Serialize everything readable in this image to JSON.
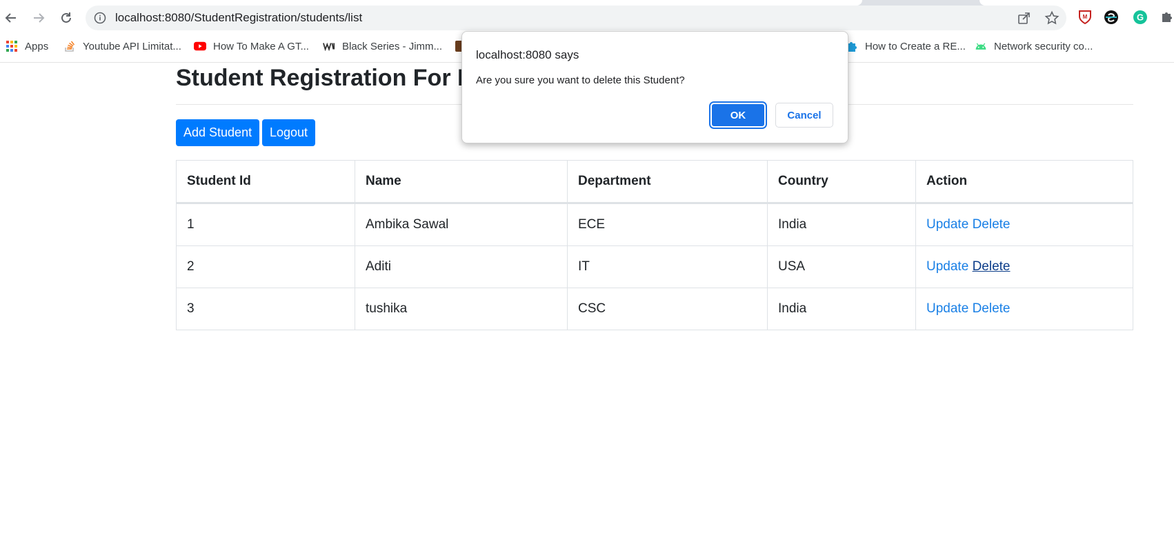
{
  "browser": {
    "url": "localhost:8080/StudentRegistration/students/list",
    "bookmarks": [
      {
        "label": "Apps",
        "icon": "apps-grid-icon"
      },
      {
        "label": "Youtube API Limitat...",
        "icon": "stackoverflow-icon"
      },
      {
        "label": "How To Make A GT...",
        "icon": "youtube-icon"
      },
      {
        "label": "Black Series - Jimm...",
        "icon": "wix-icon"
      },
      {
        "label": "How to Create a RE...",
        "icon": "puzzle-icon"
      },
      {
        "label": "Network security co...",
        "icon": "android-icon"
      }
    ]
  },
  "page": {
    "title": "Student Registration For D",
    "add_button": "Add Student",
    "logout_button": "Logout"
  },
  "table": {
    "headers": [
      "Student Id",
      "Name",
      "Department",
      "Country",
      "Action"
    ],
    "rows": [
      {
        "id": "1",
        "name": "Ambika Sawal",
        "department": "ECE",
        "country": "India",
        "update": "Update",
        "delete": "Delete"
      },
      {
        "id": "2",
        "name": "Aditi",
        "department": "IT",
        "country": "USA",
        "update": "Update",
        "delete": "Delete"
      },
      {
        "id": "3",
        "name": "tushika",
        "department": "CSC",
        "country": "India",
        "update": "Update",
        "delete": "Delete"
      }
    ]
  },
  "dialog": {
    "title": "localhost:8080 says",
    "message": "Are you sure you want to delete this Student?",
    "ok_label": "OK",
    "cancel_label": "Cancel"
  },
  "colors": {
    "primary": "#007bff",
    "link": "#1a80e6",
    "dialog_accent": "#1a73e8"
  }
}
